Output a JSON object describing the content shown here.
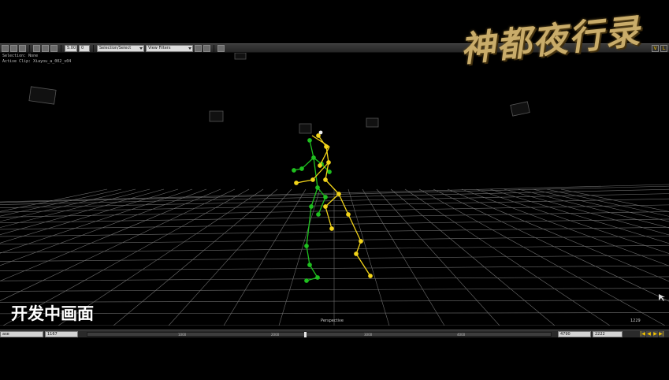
{
  "toolbar": {
    "field_a": "5.00",
    "field_b": "0",
    "dropdown_selection": "Selection/Select",
    "dropdown_view": "View Filters",
    "right_v": "V",
    "right_l": "L"
  },
  "hud": {
    "selection": "Selection: None",
    "active_clip": "Active Clip: Xiayou_a_002_s04"
  },
  "logo_text": "神都夜行录",
  "caption": "开发中画面",
  "viewport": {
    "label": "Perspective",
    "frame": "1229"
  },
  "timeline": {
    "left_field": "ase",
    "start_field": "1167",
    "ticks": [
      "1000",
      "2000",
      "3000",
      "4000"
    ],
    "end_field": "4790",
    "range_field": "2222",
    "controls": [
      "|◀",
      "◀",
      "▶",
      "▶|"
    ]
  },
  "colors": {
    "skeleton_green": "#1fbf1f",
    "skeleton_yellow": "#f2d41a",
    "grid": "#7a7a7a",
    "logo_gold": "#c9ac6a"
  }
}
